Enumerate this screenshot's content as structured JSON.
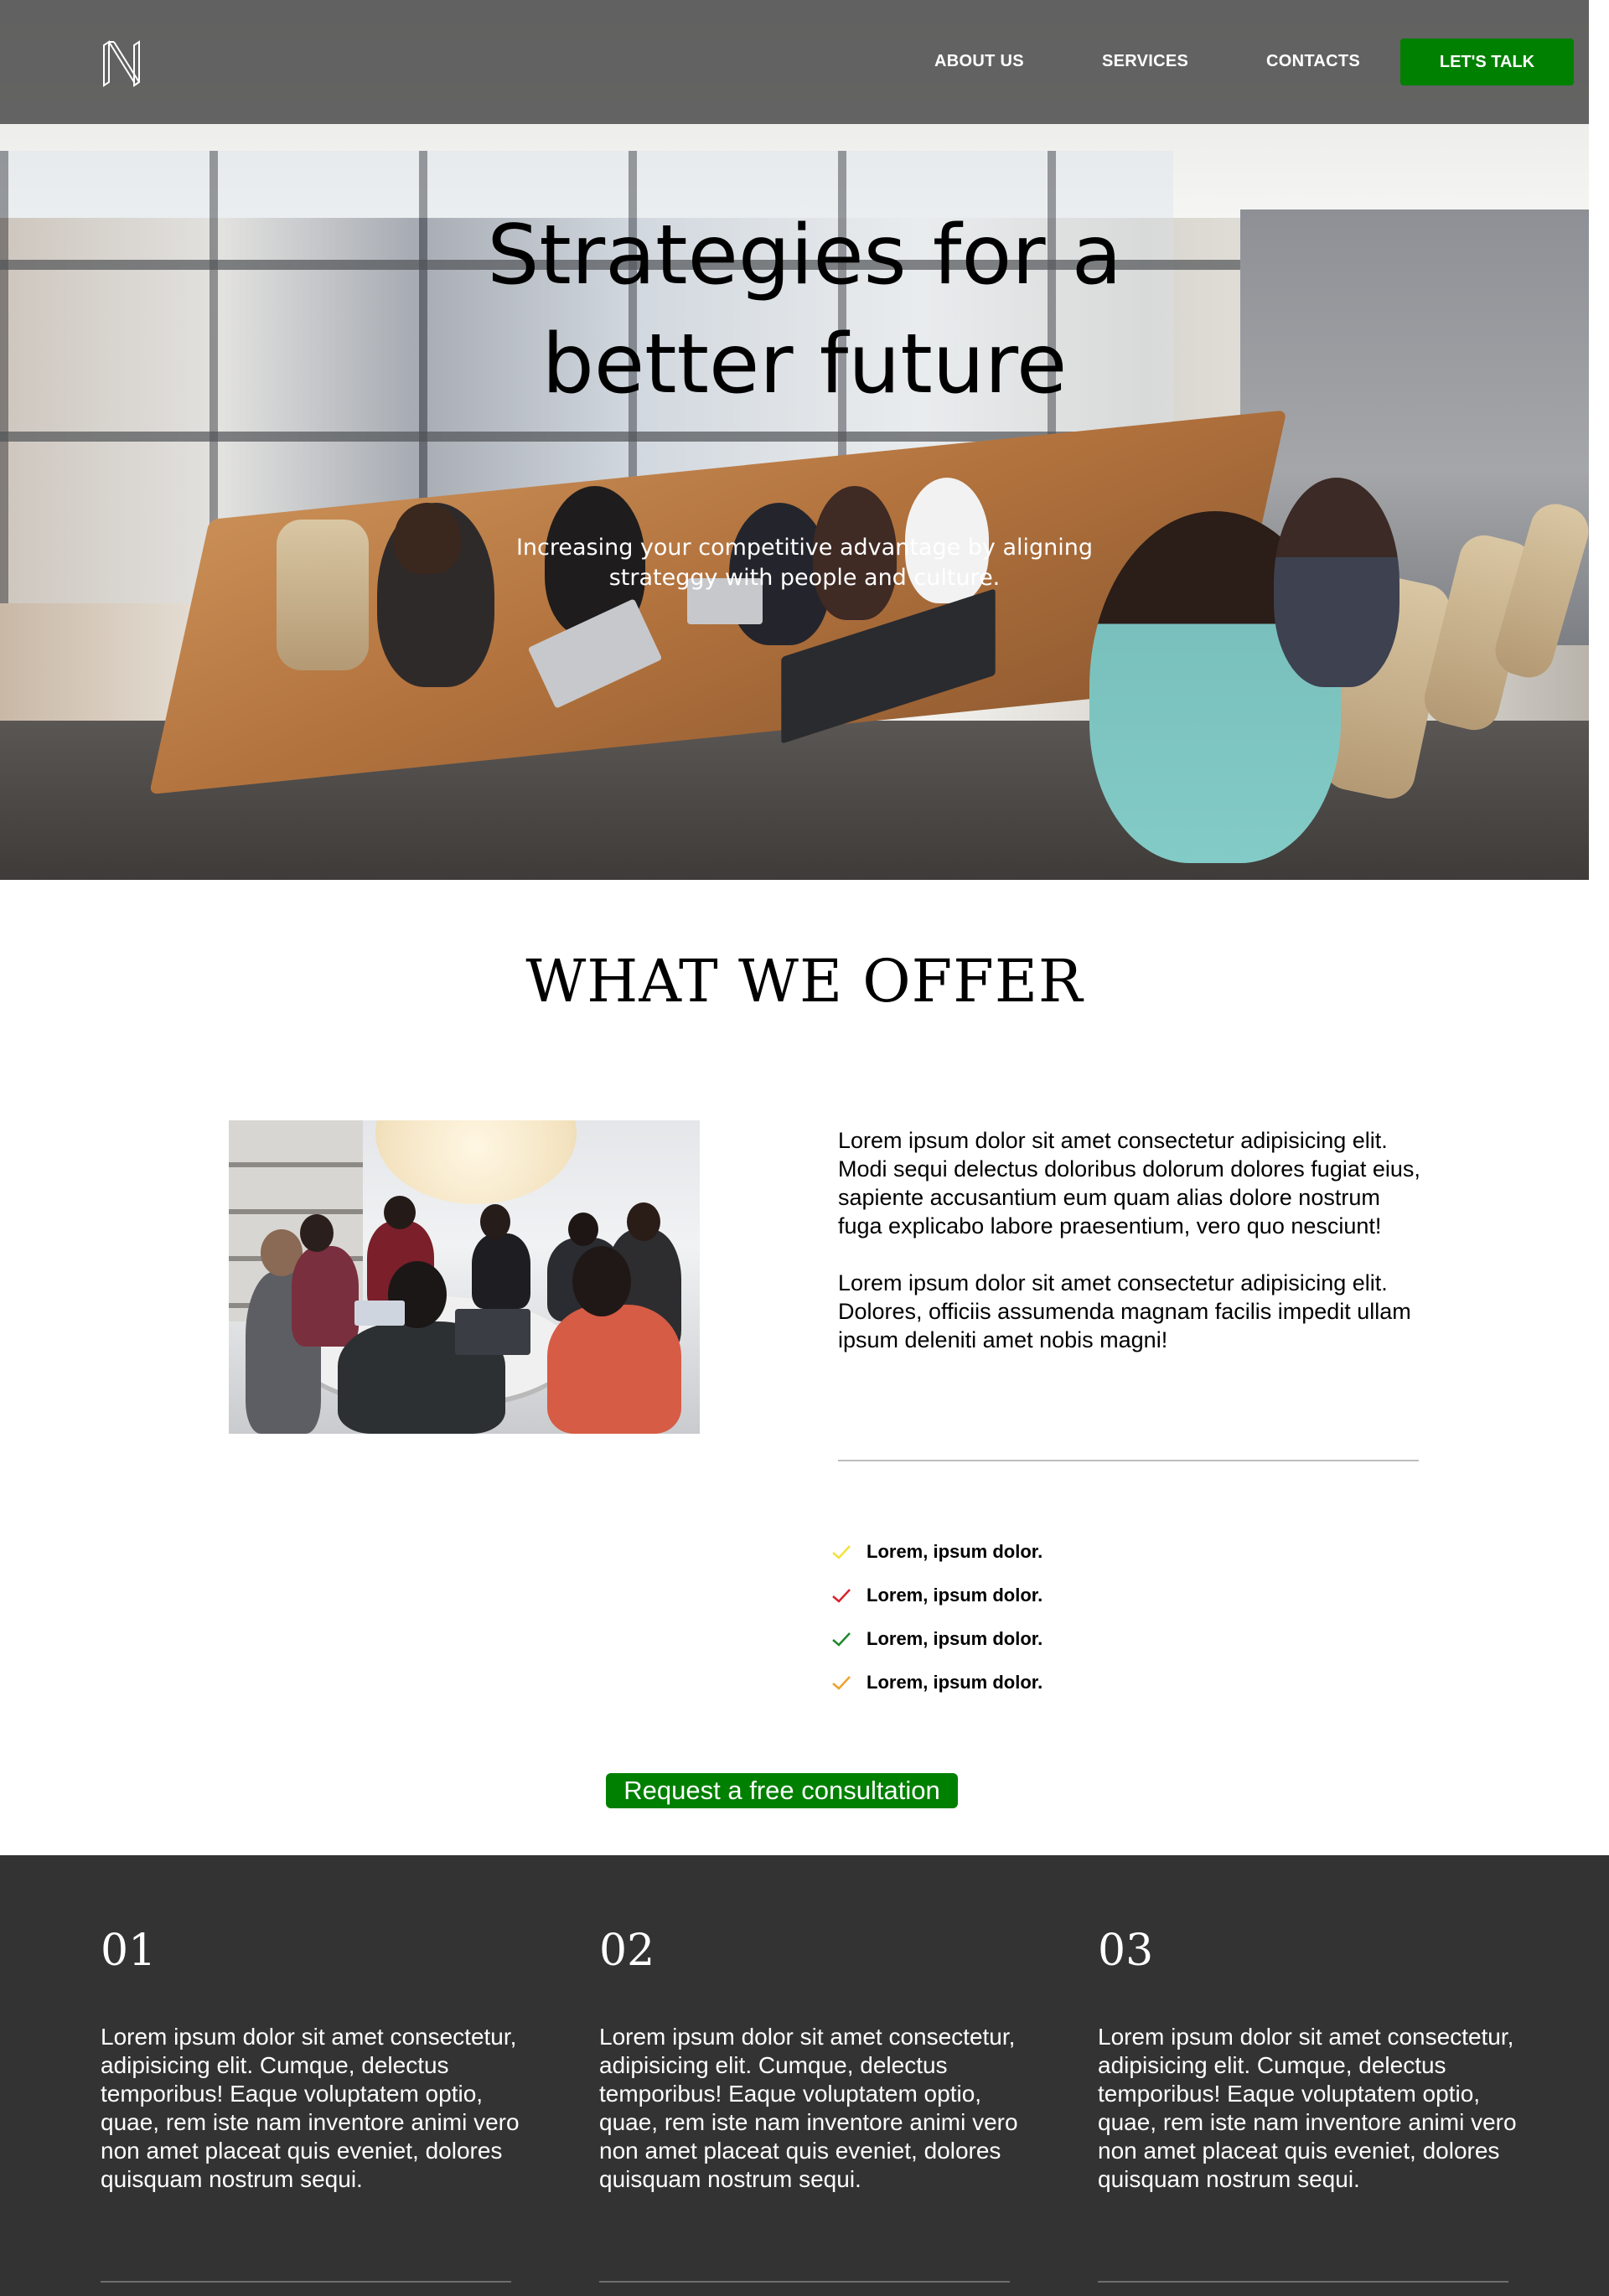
{
  "nav": {
    "logo_alt": "N",
    "links": [
      {
        "label": "ABOUT US"
      },
      {
        "label": "SERVICES"
      },
      {
        "label": "CONTACTS"
      }
    ],
    "cta_label": "LET'S TALK"
  },
  "hero": {
    "title": "Strategies for a better future",
    "subtitle": "Increasing your competitive advantage by aligning strateggy with people and culture."
  },
  "offer": {
    "title": "WHAT WE OFFER",
    "paragraphs": [
      "Lorem ipsum dolor sit amet consectetur adipisicing elit. Modi sequi delectus doloribus dolorum dolores fugiat eius, sapiente accusantium eum quam alias dolore nostrum fuga explicabo labore praesentium, vero quo nesciunt!",
      "Lorem ipsum dolor sit amet consectetur adipisicing elit. Dolores, officiis assumenda magnam facilis impedit ullam ipsum deleniti amet nobis magni!"
    ],
    "checklist": [
      {
        "label": "Lorem, ipsum dolor.",
        "icon": "check-icon",
        "color": "#f2e23a"
      },
      {
        "label": "Lorem, ipsum dolor.",
        "icon": "check-icon",
        "color": "#d9232e"
      },
      {
        "label": "Lorem, ipsum dolor.",
        "icon": "check-icon",
        "color": "#1f8a2e"
      },
      {
        "label": "Lorem, ipsum dolor.",
        "icon": "check-icon",
        "color": "#f0a12b"
      }
    ],
    "cta_label": "Request a free consultation"
  },
  "features": [
    {
      "number": "01",
      "text": "Lorem ipsum dolor sit amet consectetur, adipisicing elit. Cumque, delectus temporibus! Eaque voluptatem optio, quae, rem iste nam inventore animi vero non amet placeat quis eveniet, dolores quisquam nostrum sequi."
    },
    {
      "number": "02",
      "text": "Lorem ipsum dolor sit amet consectetur, adipisicing elit. Cumque, delectus temporibus! Eaque voluptatem optio, quae, rem iste nam inventore animi vero non amet placeat quis eveniet, dolores quisquam nostrum sequi."
    },
    {
      "number": "03",
      "text": "Lorem ipsum dolor sit amet consectetur, adipisicing elit. Cumque, delectus temporibus! Eaque voluptatem optio, quae, rem iste nam inventore animi vero non amet placeat quis eveniet, dolores quisquam nostrum sequi."
    }
  ],
  "colors": {
    "accent_green": "#008000",
    "navbar_bg": "#505050",
    "dark_section_bg": "#333333"
  }
}
